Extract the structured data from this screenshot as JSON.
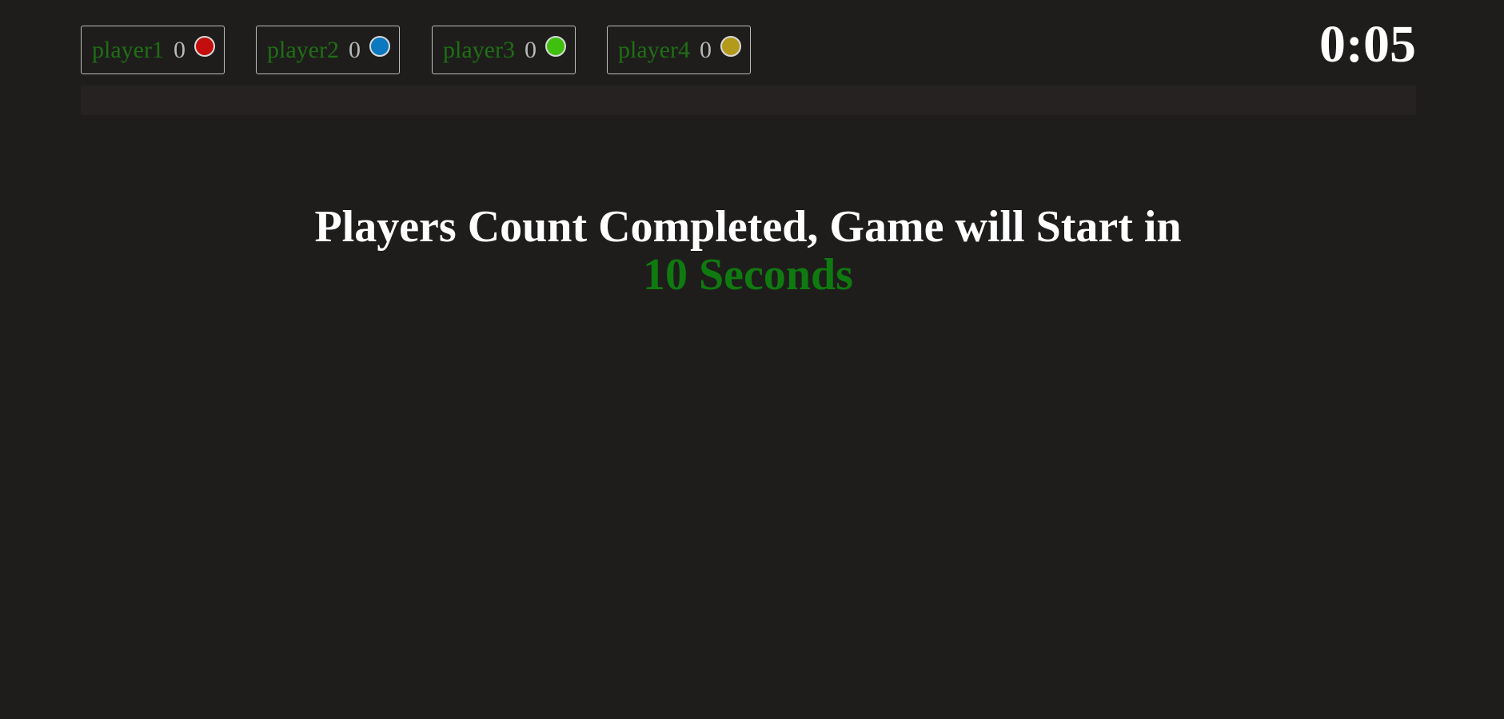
{
  "header": {
    "players": [
      {
        "name": "player1",
        "score": "0",
        "color": "#c40d0d"
      },
      {
        "name": "player2",
        "score": "0",
        "color": "#0c78c0"
      },
      {
        "name": "player3",
        "score": "0",
        "color": "#3fbf10"
      },
      {
        "name": "player4",
        "score": "0",
        "color": "#b49a1a"
      }
    ],
    "timer": "0:05"
  },
  "progress": {
    "fraction": 0
  },
  "message": {
    "line1": "Players Count Completed, Game will Start in",
    "countdown": "10 Seconds"
  },
  "colors": {
    "background": "#1e1d1c",
    "bar_background": "#252221",
    "player_name": "#1f6f14",
    "countdown": "#0f7a0f"
  }
}
